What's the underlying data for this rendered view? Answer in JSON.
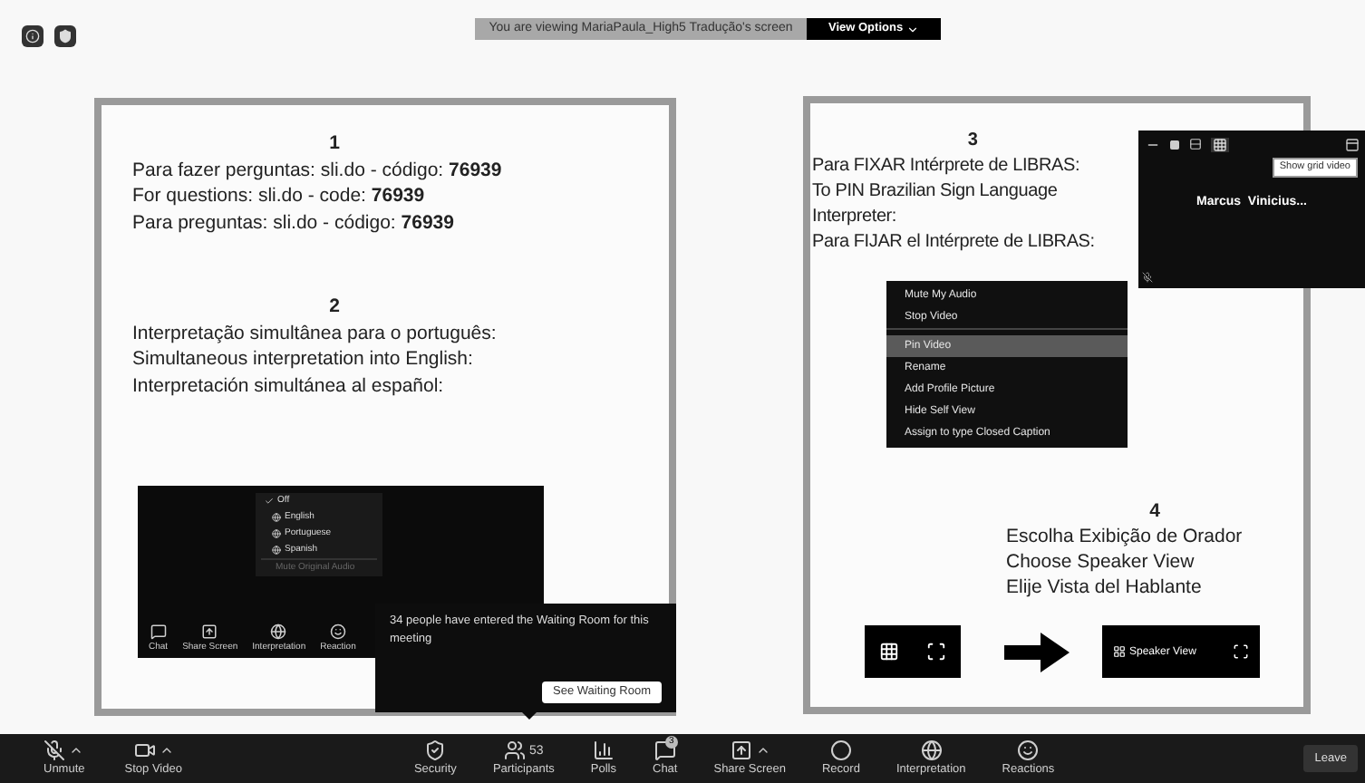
{
  "top_bar": {
    "banner": "You are viewing MariaPaula_High5 Tradução's screen",
    "view_options": "View Options"
  },
  "slide": {
    "section_1": {
      "number": "1",
      "lines": [
        "Para fazer perguntas: sli.do - código:  **76939**",
        "For questions: sli.do - code: **76939**",
        "Para preguntas: sli.do - código:  **76939**"
      ]
    },
    "section_2": {
      "number": "2",
      "lines": [
        "Interpretação simultânea para o português:",
        "Simultaneous interpretation into English:",
        "Interpretación simultánea al español:"
      ],
      "screenshot": {
        "menu": [
          {
            "label": "Off",
            "checked": true,
            "disabled": false
          },
          {
            "label": "English",
            "checked": false,
            "disabled": false
          },
          {
            "label": "Portuguese",
            "checked": false,
            "disabled": false
          },
          {
            "label": "Spanish",
            "checked": false,
            "disabled": false
          },
          {
            "label": "Mute Original Audio",
            "checked": false,
            "disabled": true
          }
        ],
        "toolbar": [
          {
            "kind": "chat",
            "label": "Chat"
          },
          {
            "kind": "share",
            "label": "Share Screen"
          },
          {
            "kind": "globe",
            "label": "Interpretation"
          },
          {
            "kind": "smile",
            "label": "Reaction"
          }
        ]
      }
    },
    "section_3": {
      "number": "3",
      "lines": [
        "Para FIXAR Intérprete de LIBRAS:",
        "To PIN Brazilian Sign Language Interpreter:",
        "Para FIJAR el Intérprete de LIBRAS:"
      ],
      "context_menu": [
        {
          "label": "Mute My Audio",
          "selected": false,
          "separator_after": false
        },
        {
          "label": "Stop Video",
          "selected": false,
          "separator_after": true
        },
        {
          "label": "Pin Video",
          "selected": true,
          "separator_after": false
        },
        {
          "label": "Rename",
          "selected": false,
          "separator_after": false
        },
        {
          "label": "Add Profile Picture",
          "selected": false,
          "separator_after": false
        },
        {
          "label": "Hide Self View",
          "selected": false,
          "separator_after": false
        },
        {
          "label": "Assign to type Closed Caption",
          "selected": false,
          "separator_after": false
        }
      ]
    },
    "section_4": {
      "number": "4",
      "lines": [
        "Escolha Exibição de Orador",
        "Choose Speaker View",
        "Elije Vista del Hablante"
      ],
      "speaker_view": "Speaker View"
    }
  },
  "video_window": {
    "tooltip": "Show grid video",
    "name": "Marcus  Vinicius..."
  },
  "waiting_room_popup": {
    "message": "34 people have entered the Waiting Room for this meeting",
    "button": "See Waiting Room"
  },
  "toolbar": {
    "left": [
      {
        "kind": "mic",
        "label": "Unmute",
        "caret": true
      },
      {
        "kind": "video",
        "label": "Stop Video",
        "caret": true
      }
    ],
    "center": [
      {
        "kind": "shield",
        "label": "Security",
        "caret": false
      },
      {
        "kind": "people",
        "label": "Participants",
        "count": "53",
        "caret": false
      },
      {
        "kind": "polls",
        "label": "Polls",
        "caret": false
      },
      {
        "kind": "chat",
        "label": "Chat",
        "badge": "3",
        "caret": false
      },
      {
        "kind": "share",
        "label": "Share Screen",
        "caret": true
      },
      {
        "kind": "record",
        "label": "Record",
        "caret": false
      },
      {
        "kind": "globe",
        "label": "Interpretation",
        "caret": false
      },
      {
        "kind": "smile",
        "label": "Reactions",
        "caret": false
      }
    ],
    "leave": "Leave"
  }
}
